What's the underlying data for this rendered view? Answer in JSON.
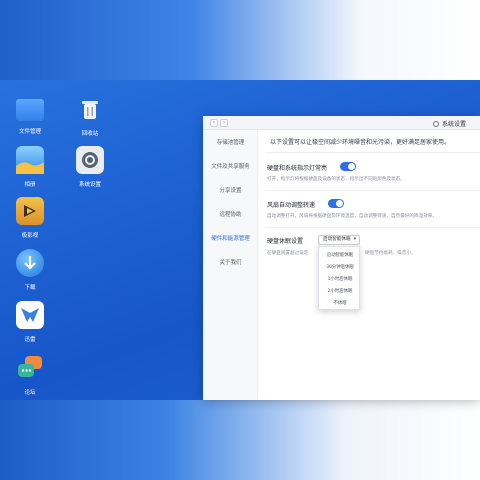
{
  "desktop": {
    "icons": [
      {
        "label": "文件管理",
        "icon": "folder-icon",
        "color": "#3d8ef0"
      },
      {
        "label": "回收站",
        "icon": "trash-icon",
        "color": "#7a8290"
      },
      {
        "label": "相册",
        "icon": "photo-icon",
        "color": "#3aa0e8"
      },
      {
        "label": "系统设置",
        "icon": "settings-icon",
        "color": "#5a6270"
      },
      {
        "label": "极影视",
        "icon": "video-icon",
        "color": "#e0a030"
      },
      {
        "label": "下载",
        "icon": "download-icon",
        "color": "#2e8de0"
      },
      {
        "label": "迅雷",
        "icon": "thunder-icon",
        "color": "#3b7fe0"
      },
      {
        "label": "论坛",
        "icon": "forum-icon",
        "color": "#f08a3c"
      }
    ]
  },
  "window": {
    "title": "系统设置",
    "nav_back": "‹",
    "nav_forward": "›",
    "sidebar": [
      {
        "label": "存储池管理"
      },
      {
        "label": "文件及共享服务"
      },
      {
        "label": "分享设置"
      },
      {
        "label": "远程协助"
      },
      {
        "label": "硬件和能源管理",
        "active": true
      },
      {
        "label": "关于我们"
      }
    ],
    "intro": "以下设置可以让极空间减少环境噪音和光污染，更好满足居家使用。",
    "settings": [
      {
        "title": "硬盘和系统指示灯常亮",
        "desc": "打开，指示灯将根据硬盘及设备的状态，指示出不同的颜色及状态。",
        "toggle_on": true
      },
      {
        "title": "风扇自动调整转速",
        "desc": "自动调整打开，风扇将根据硬盘及环境温度，自动调整转速，自然最好的降温效果。",
        "toggle_on": true
      }
    ],
    "sleep": {
      "title": "硬盘休眠设置",
      "desc_left": "在硬盘闲置超过设定",
      "desc_right": "硬盘节约能耗，噪音小。",
      "selected": "启动智能休眠",
      "options": [
        "启动智能休眠",
        "30分钟后休眠",
        "1小时后休眠",
        "2小时后休眠",
        "不休眠"
      ]
    }
  },
  "colors": {
    "accent": "#2f6fe4"
  }
}
